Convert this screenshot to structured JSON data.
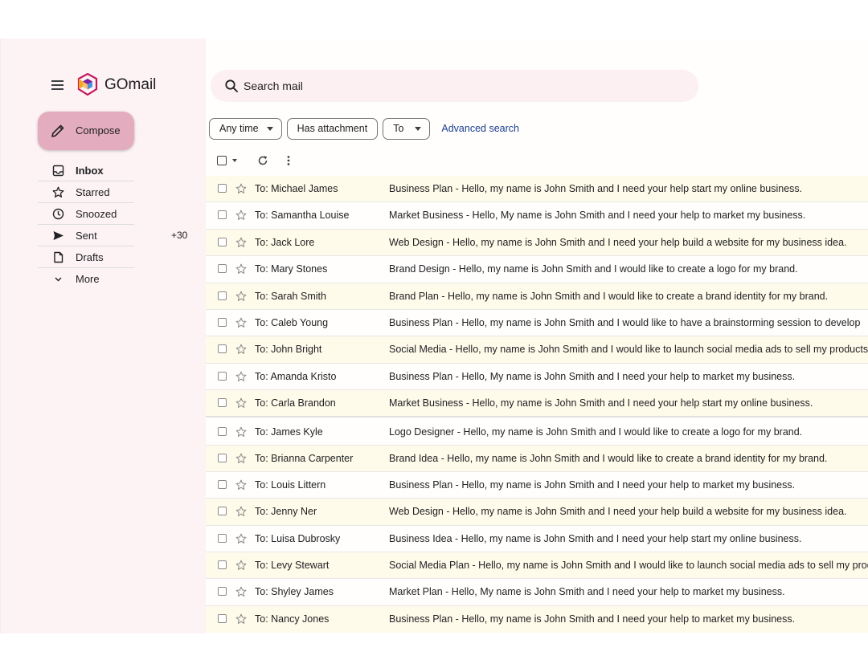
{
  "app": {
    "title": "GOmail",
    "logo_colors": [
      "#c2185b",
      "#f5a623",
      "#7b1fa2",
      "#4a90e2"
    ]
  },
  "colors": {
    "sidebar_bg": "#fdf2f4",
    "compose_bg": "#e3adbf",
    "row_alt_bg": "#fffbea",
    "link": "#1a3d8f"
  },
  "sidebar": {
    "compose_label": "Compose",
    "items": [
      {
        "label": "Inbox",
        "icon": "inbox-icon",
        "count": ""
      },
      {
        "label": "Starred",
        "icon": "star-icon",
        "count": ""
      },
      {
        "label": "Snoozed",
        "icon": "clock-icon",
        "count": ""
      },
      {
        "label": "Sent",
        "icon": "send-icon",
        "count": "+30"
      },
      {
        "label": "Drafts",
        "icon": "document-icon",
        "count": ""
      },
      {
        "label": "More",
        "icon": "chevron-down-icon",
        "count": ""
      }
    ]
  },
  "search": {
    "placeholder": "Search mail"
  },
  "filters": {
    "any_time": "Any time",
    "has_attachment": "Has attachment",
    "to": "To",
    "advanced_search": "Advanced search"
  },
  "emails": [
    {
      "to": "To: Michael James",
      "subject": "Business Plan - Hello, my name is John Smith and I need your help start my online business."
    },
    {
      "to": "To: Samantha Louise",
      "subject": "Market Business - Hello, My name is John Smith and I need your help to market my business."
    },
    {
      "to": "To: Jack Lore",
      "subject": "Web Design - Hello, my name is John Smith and I need your help build a website for my business idea."
    },
    {
      "to": "To: Mary Stones",
      "subject": "Brand Design - Hello, my name is John Smith and I would like to create a logo for my brand."
    },
    {
      "to": "To: Sarah Smith",
      "subject": "Brand Plan - Hello, my name is John Smith and I would like to create a brand identity for my brand."
    },
    {
      "to": "To: Caleb Young",
      "subject": "Business Plan - Hello, my name is John Smith and I would like to have a brainstorming session to develop"
    },
    {
      "to": "To: John Bright",
      "subject": "Social Media - Hello, my name is John Smith and I would like to launch social media ads to sell my products."
    },
    {
      "to": "To: Amanda Kristo",
      "subject": "Business Plan - Hello, My name is John Smith and I need your help to market my business."
    },
    {
      "to": "To: Carla Brandon",
      "subject": "Market Business - Hello, my name is John Smith and I need your help start my online business."
    },
    {
      "to": "To: James Kyle",
      "subject": "Logo Designer - Hello, my name is John Smith and I would like to create a logo for my brand."
    },
    {
      "to": "To: Brianna Carpenter",
      "subject": "Brand Idea - Hello, my name is John Smith and I would like to create a brand identity for my brand."
    },
    {
      "to": "To: Louis Littern",
      "subject": "Business Plan - Hello, my name is John Smith and I need your help to market my business."
    },
    {
      "to": "To: Jenny Ner",
      "subject": "Web Design - Hello, my name is John Smith and I need your help build a website for my business idea."
    },
    {
      "to": "To: Luisa Dubrosky",
      "subject": "Business Idea - Hello, my name is John Smith and I need your help start my online business."
    },
    {
      "to": "To: Levy Stewart",
      "subject": "Social Media Plan - Hello, my name is John Smith and I would like to launch social media ads to sell my produ"
    },
    {
      "to": "To: Shyley James",
      "subject": "Market Plan - Hello, My name is John Smith and I need your help to market my business."
    },
    {
      "to": "To: Nancy Jones",
      "subject": "Business Plan - Hello, my name is John Smith and I need your help to market my business."
    }
  ]
}
